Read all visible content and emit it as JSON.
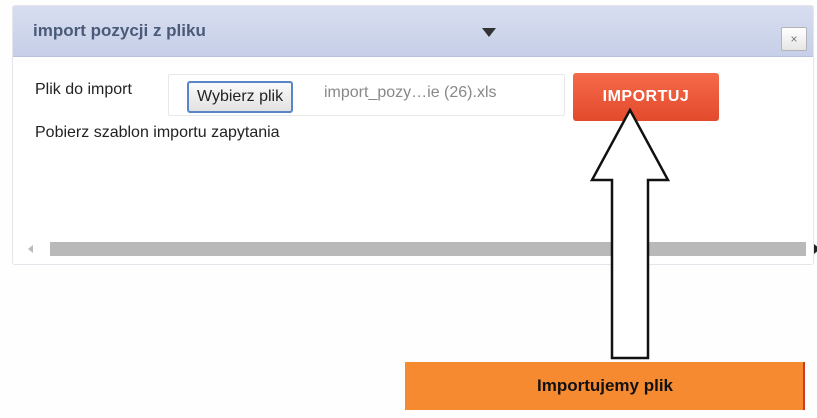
{
  "dialog": {
    "title": "import pozycji z pliku",
    "close_label": "×"
  },
  "form": {
    "file_label": "Plik do import",
    "choose_button_label": "Wybierz plik",
    "file_name": "import_pozy…ie (26).xls",
    "import_button_label": "IMPORTUJ",
    "template_link_label": "Pobierz szablon importu zapytania"
  },
  "annotation": {
    "callout_text": "Importujemy plik"
  },
  "colors": {
    "titlebar": "#c6cfe8",
    "import_button": "#e8502f",
    "callout": "#f58a30",
    "choose_button_border": "#5a85c8"
  },
  "icons": {
    "close": "close-icon",
    "marker": "triangle-down-icon",
    "scroll_left": "arrow-left-icon",
    "scroll_right": "arrow-right-icon",
    "callout_arrow": "arrow-up-icon"
  }
}
